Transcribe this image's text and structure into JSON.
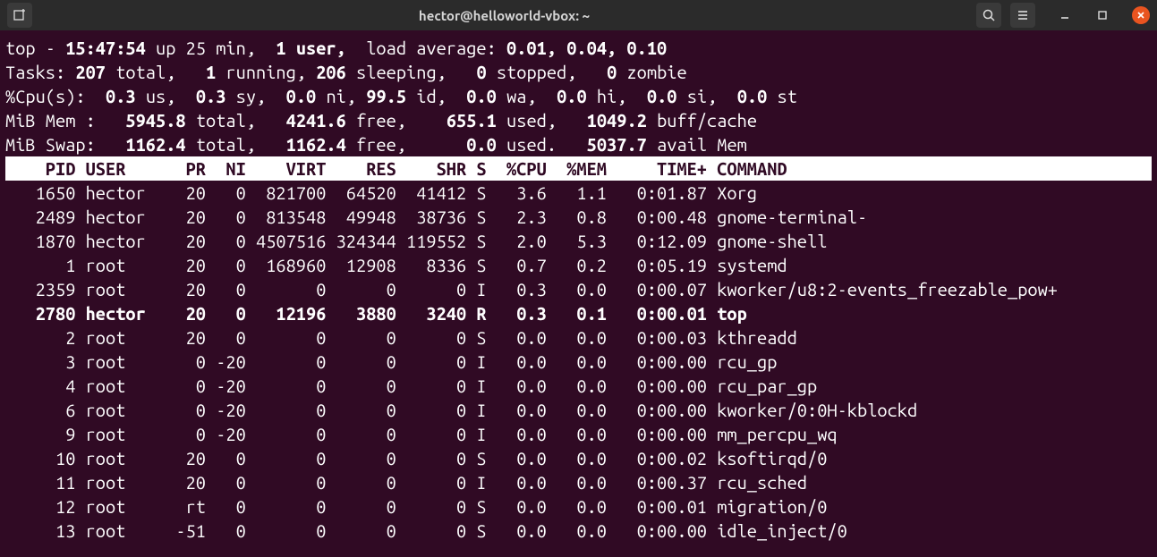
{
  "titlebar": {
    "title": "hector@helloworld-vbox: ~"
  },
  "summary": {
    "line1_a": "top - ",
    "time": "15:47:54",
    "up": " up 25 min,  ",
    "users": "1 user,",
    "load_lbl": "  load average: ",
    "loads": "0.01, 0.04, 0.10",
    "tasks_lbl": "Tasks:",
    "tasks_total": " 207 ",
    "total_lbl": "total,   ",
    "running": "1 ",
    "running_lbl": "running, ",
    "sleeping": "206 ",
    "sleeping_lbl": "sleeping,   ",
    "stopped": "0 ",
    "stopped_lbl": "stopped,   ",
    "zombie": "0 ",
    "zombie_lbl": "zombie",
    "cpu_lbl": "%Cpu(s):  ",
    "cpu_us": "0.3 ",
    "us": "us,  ",
    "cpu_sy": "0.3 ",
    "sy": "sy,  ",
    "cpu_ni": "0.0 ",
    "ni": "ni, ",
    "cpu_id": "99.5 ",
    "id": "id,  ",
    "cpu_wa": "0.0 ",
    "wa": "wa,  ",
    "cpu_hi": "0.0 ",
    "hi": "hi,  ",
    "cpu_si": "0.0 ",
    "si": "si,  ",
    "cpu_st": "0.0 ",
    "st": "st",
    "mem_lbl": "MiB Mem :   ",
    "mem_total": "5945.8 ",
    "mt": "total,   ",
    "mem_free": "4241.6 ",
    "mf": "free,    ",
    "mem_used": "655.1 ",
    "mu": "used,   ",
    "mem_buff": "1049.2 ",
    "mb": "buff/cache",
    "swap_lbl": "MiB Swap:   ",
    "swap_total": "1162.4 ",
    "swt": "total,   ",
    "swap_free": "1162.4 ",
    "swf": "free,      ",
    "swap_used": "0.0 ",
    "swu": "used.   ",
    "swap_avail": "5037.7 ",
    "swa": "avail Mem"
  },
  "header": "    PID USER      PR  NI    VIRT    RES    SHR S  %CPU  %MEM     TIME+ COMMAND                                                 ",
  "rows": [
    {
      "pid": "1650",
      "user": "hector",
      "pr": "20",
      "ni": "0",
      "virt": "821700",
      "res": "64520",
      "shr": "41412",
      "s": "S",
      "cpu": "3.6",
      "mem": "1.1",
      "time": "0:01.87",
      "cmd": "Xorg",
      "bold": false
    },
    {
      "pid": "2489",
      "user": "hector",
      "pr": "20",
      "ni": "0",
      "virt": "813548",
      "res": "49948",
      "shr": "38736",
      "s": "S",
      "cpu": "2.3",
      "mem": "0.8",
      "time": "0:00.48",
      "cmd": "gnome-terminal-",
      "bold": false
    },
    {
      "pid": "1870",
      "user": "hector",
      "pr": "20",
      "ni": "0",
      "virt": "4507516",
      "res": "324344",
      "shr": "119552",
      "s": "S",
      "cpu": "2.0",
      "mem": "5.3",
      "time": "0:12.09",
      "cmd": "gnome-shell",
      "bold": false
    },
    {
      "pid": "1",
      "user": "root",
      "pr": "20",
      "ni": "0",
      "virt": "168960",
      "res": "12908",
      "shr": "8336",
      "s": "S",
      "cpu": "0.7",
      "mem": "0.2",
      "time": "0:05.19",
      "cmd": "systemd",
      "bold": false
    },
    {
      "pid": "2359",
      "user": "root",
      "pr": "20",
      "ni": "0",
      "virt": "0",
      "res": "0",
      "shr": "0",
      "s": "I",
      "cpu": "0.3",
      "mem": "0.0",
      "time": "0:00.07",
      "cmd": "kworker/u8:2-events_freezable_pow+",
      "bold": false
    },
    {
      "pid": "2780",
      "user": "hector",
      "pr": "20",
      "ni": "0",
      "virt": "12196",
      "res": "3880",
      "shr": "3240",
      "s": "R",
      "cpu": "0.3",
      "mem": "0.1",
      "time": "0:00.01",
      "cmd": "top",
      "bold": true
    },
    {
      "pid": "2",
      "user": "root",
      "pr": "20",
      "ni": "0",
      "virt": "0",
      "res": "0",
      "shr": "0",
      "s": "S",
      "cpu": "0.0",
      "mem": "0.0",
      "time": "0:00.03",
      "cmd": "kthreadd",
      "bold": false
    },
    {
      "pid": "3",
      "user": "root",
      "pr": "0",
      "ni": "-20",
      "virt": "0",
      "res": "0",
      "shr": "0",
      "s": "I",
      "cpu": "0.0",
      "mem": "0.0",
      "time": "0:00.00",
      "cmd": "rcu_gp",
      "bold": false
    },
    {
      "pid": "4",
      "user": "root",
      "pr": "0",
      "ni": "-20",
      "virt": "0",
      "res": "0",
      "shr": "0",
      "s": "I",
      "cpu": "0.0",
      "mem": "0.0",
      "time": "0:00.00",
      "cmd": "rcu_par_gp",
      "bold": false
    },
    {
      "pid": "6",
      "user": "root",
      "pr": "0",
      "ni": "-20",
      "virt": "0",
      "res": "0",
      "shr": "0",
      "s": "I",
      "cpu": "0.0",
      "mem": "0.0",
      "time": "0:00.00",
      "cmd": "kworker/0:0H-kblockd",
      "bold": false
    },
    {
      "pid": "9",
      "user": "root",
      "pr": "0",
      "ni": "-20",
      "virt": "0",
      "res": "0",
      "shr": "0",
      "s": "I",
      "cpu": "0.0",
      "mem": "0.0",
      "time": "0:00.00",
      "cmd": "mm_percpu_wq",
      "bold": false
    },
    {
      "pid": "10",
      "user": "root",
      "pr": "20",
      "ni": "0",
      "virt": "0",
      "res": "0",
      "shr": "0",
      "s": "S",
      "cpu": "0.0",
      "mem": "0.0",
      "time": "0:00.02",
      "cmd": "ksoftirqd/0",
      "bold": false
    },
    {
      "pid": "11",
      "user": "root",
      "pr": "20",
      "ni": "0",
      "virt": "0",
      "res": "0",
      "shr": "0",
      "s": "I",
      "cpu": "0.0",
      "mem": "0.0",
      "time": "0:00.37",
      "cmd": "rcu_sched",
      "bold": false
    },
    {
      "pid": "12",
      "user": "root",
      "pr": "rt",
      "ni": "0",
      "virt": "0",
      "res": "0",
      "shr": "0",
      "s": "S",
      "cpu": "0.0",
      "mem": "0.0",
      "time": "0:00.01",
      "cmd": "migration/0",
      "bold": false
    },
    {
      "pid": "13",
      "user": "root",
      "pr": "-51",
      "ni": "0",
      "virt": "0",
      "res": "0",
      "shr": "0",
      "s": "S",
      "cpu": "0.0",
      "mem": "0.0",
      "time": "0:00.00",
      "cmd": "idle_inject/0",
      "bold": false
    }
  ]
}
